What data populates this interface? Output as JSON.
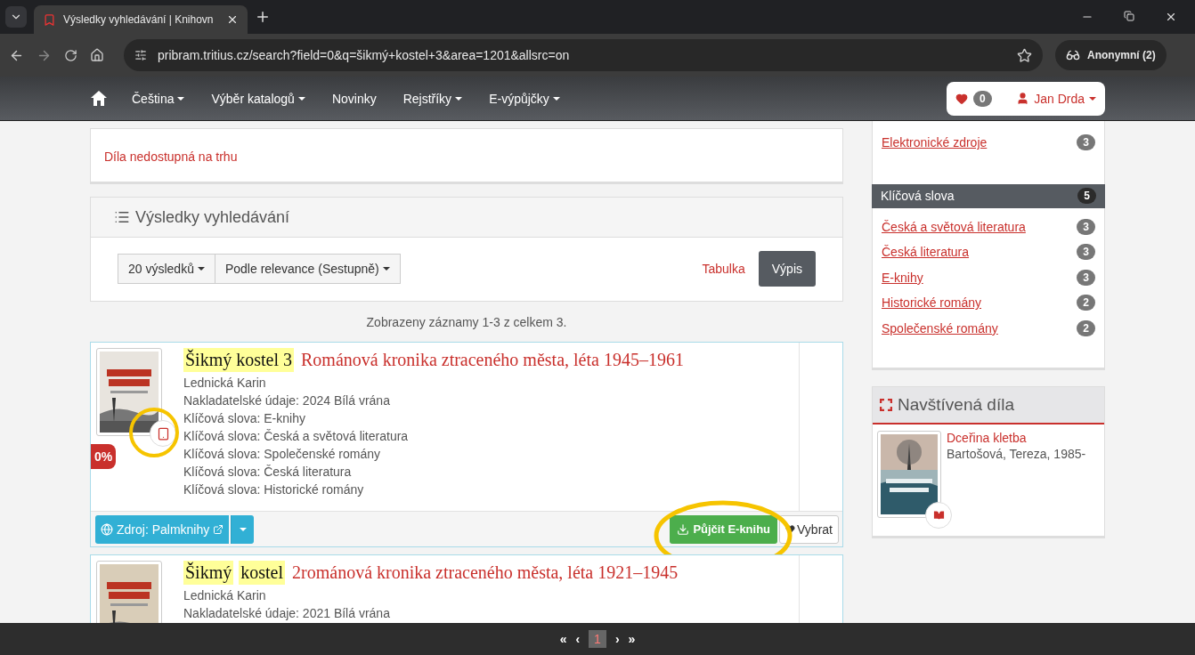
{
  "browser": {
    "tab_title": "Výsledky vyhledávání | Knihovn",
    "url": "pribram.tritius.cz/search?field=0&q=šikmý+kostel+3&area=1201&allsrc=on",
    "profile": "Anonymní (2)"
  },
  "nav": {
    "items": [
      {
        "label": "Čeština",
        "dropdown": true
      },
      {
        "label": "Výběr katalogů",
        "dropdown": true
      },
      {
        "label": "Novinky",
        "dropdown": false
      },
      {
        "label": "Rejstříky",
        "dropdown": true
      },
      {
        "label": "E-výpůjčky",
        "dropdown": true
      }
    ],
    "favorites_count": "0",
    "user": "Jan Drda"
  },
  "top_panel": {
    "link": "Díla nedostupná na trhu"
  },
  "results": {
    "title": "Výsledky vyhledávání",
    "page_size": "20 výsledků",
    "sort": "Podle relevance (Sestupně)",
    "views": [
      {
        "label": "Tabulka",
        "selected": false
      },
      {
        "label": "Výpis",
        "selected": true
      }
    ],
    "summary": "Zobrazeny záznamy 1-3 z celkem 3."
  },
  "records": [
    {
      "title": [
        {
          "text": "Šikmý  kostel 3",
          "highlighted": true
        },
        {
          "text": "Románová kronika ztraceného města, léta 1945–1961",
          "highlighted": false
        }
      ],
      "lines": [
        "Lednická Karin",
        "Nakladatelské údaje: 2024 Bílá vrána",
        "Klíčová slova: E-knihy",
        "Klíčová slova: Česká a světová literatura",
        "Klíčová slova: Společenské romány",
        "Klíčová slova: Česká literatura",
        "Klíčová slova: Historické romány"
      ],
      "badge": "0%",
      "source": "Zdroj: Palmknihy",
      "borrow": "Půjčit E-knihu",
      "select": "Vybrat"
    },
    {
      "title": [
        {
          "text": "Šikmý",
          "highlighted": true
        },
        {
          "text": "kostel",
          "highlighted": true
        },
        {
          "text": "2románová kronika ztraceného města, léta 1921–1945",
          "highlighted": false
        }
      ],
      "lines": [
        "Lednická Karin",
        "Nakladatelské údaje: 2021 Bílá vrána"
      ]
    }
  ],
  "sidebar": {
    "facets": [
      {
        "label": "Elektronické zdroje",
        "count": "3"
      }
    ],
    "group": {
      "title": "Klíčová slova",
      "count": "5",
      "items": [
        {
          "label": "Česká a světová literatura",
          "count": "3"
        },
        {
          "label": "Česká literatura",
          "count": "3"
        },
        {
          "label": "E-knihy",
          "count": "3"
        },
        {
          "label": "Historické romány",
          "count": "2"
        },
        {
          "label": "Společenské romány",
          "count": "2"
        }
      ]
    },
    "visited": {
      "title": "Navštívená díla",
      "items": [
        {
          "title": "Dceřina kletba",
          "author": "Bartošová, Tereza, 1985-"
        }
      ]
    }
  },
  "pagination": {
    "first": "«",
    "prev": "‹",
    "pages": [
      {
        "label": "1",
        "selected": true
      }
    ],
    "next": "›",
    "last": "»"
  }
}
